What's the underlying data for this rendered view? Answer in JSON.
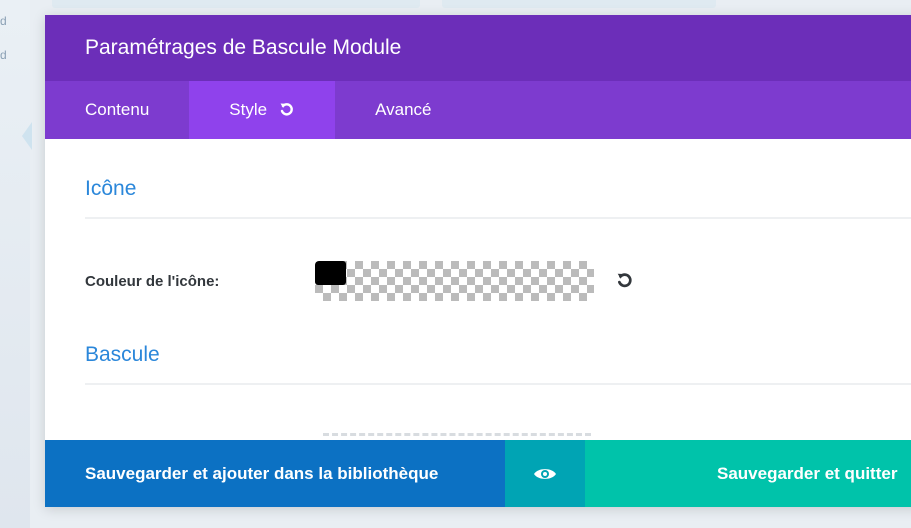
{
  "background": {
    "left_glyph_1": "d",
    "left_glyph_2": "d"
  },
  "modal": {
    "title": "Paramétrages de Bascule Module",
    "tabs": [
      {
        "label": "Contenu",
        "active": false
      },
      {
        "label": "Style",
        "active": true,
        "has_reset_icon": true
      },
      {
        "label": "Avancé",
        "active": false
      }
    ],
    "sections": [
      {
        "title": "Icône",
        "fields": [
          {
            "label": "Couleur de l'icône:",
            "type": "color",
            "value": "#000000",
            "icon": "reset-icon"
          }
        ]
      },
      {
        "title": "Bascule"
      }
    ],
    "footer": {
      "save_library_label": "Sauvegarder et ajouter dans la bibliothèque",
      "preview_icon": "eye-icon",
      "save_quit_label": "Sauvegarder et quitter"
    }
  },
  "colors": {
    "header": "#6c2eb9",
    "tabbar": "#7d3bcf",
    "tab_active": "#8f42ec",
    "section_title": "#2b87da",
    "save_library": "#0c71c3",
    "preview": "#00a4b4",
    "save_quit": "#00c3aa"
  }
}
